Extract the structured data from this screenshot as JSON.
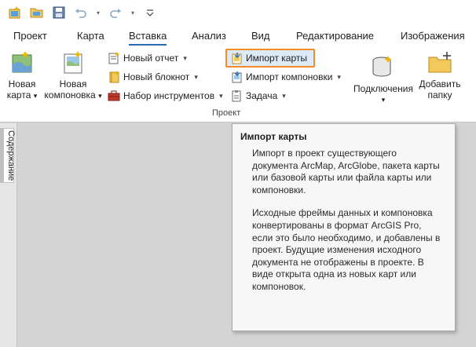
{
  "quick_access": {
    "icons": [
      "new-project-icon",
      "open-project-icon",
      "save-project-icon",
      "undo-icon",
      "redo-icon",
      "customize-toolbar-icon"
    ]
  },
  "tabs": [
    "Проект",
    "Карта",
    "Вставка",
    "Анализ",
    "Вид",
    "Редактирование",
    "Изображения"
  ],
  "active_tab": "Вставка",
  "ribbon": {
    "new_map": {
      "line1": "Новая",
      "line2": "карта",
      "chevron": "▾"
    },
    "new_layout": {
      "line1": "Новая",
      "line2": "компоновка",
      "chevron": "▾"
    },
    "new_report": {
      "label": "Новый отчет",
      "chevron": "▾"
    },
    "new_notebook": {
      "label": "Новый блокнот",
      "chevron": "▾"
    },
    "toolbox": {
      "label": "Набор инструментов",
      "chevron": "▾"
    },
    "import_map": {
      "label": "Импорт карты"
    },
    "import_layout": {
      "label": "Импорт компоновки",
      "chevron": "▾"
    },
    "task": {
      "label": "Задача",
      "chevron": "▾"
    },
    "connections": {
      "label": "Подключения",
      "chevron": "▾"
    },
    "add_folder": {
      "line1": "Добавить",
      "line2": "папку"
    },
    "group_label": "Проект"
  },
  "contents_panel": {
    "label": "Содержание"
  },
  "tooltip": {
    "title": "Импорт карты",
    "paragraph1": "Импорт в проект существующего документа ArcMap, ArcGlobe, пакета карты или базовой карты или файла карты или компоновки.",
    "paragraph2": "Исходные фреймы данных и компоновка конвертированы в формат ArcGIS Pro, если это было необходимо, и добавлены в проект. Будущие изменения исходного документа не отображены в проекте. В виде открыта одна из новых карт или компоновок."
  }
}
